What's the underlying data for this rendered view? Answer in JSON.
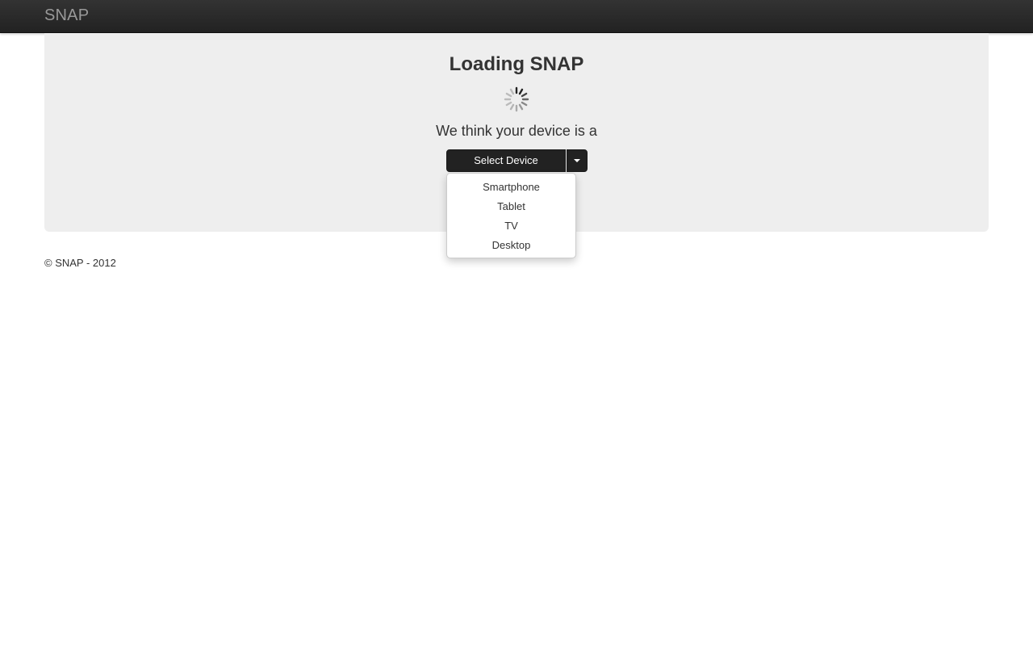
{
  "navbar": {
    "brand": "SNAP"
  },
  "hero": {
    "title": "Loading SNAP",
    "subtitle": "We think your device is a",
    "spinner_icon": "spinner-icon"
  },
  "device_select": {
    "button_label": "Select Device",
    "caret_icon": "caret-down-icon",
    "options": [
      "Smartphone",
      "Tablet",
      "TV",
      "Desktop"
    ]
  },
  "footer": {
    "text": "© SNAP - 2012"
  },
  "colors": {
    "navbar": "#222222",
    "brand": "#999999",
    "hero_background": "#eeeeee",
    "button": "#222222",
    "text": "#333333"
  }
}
